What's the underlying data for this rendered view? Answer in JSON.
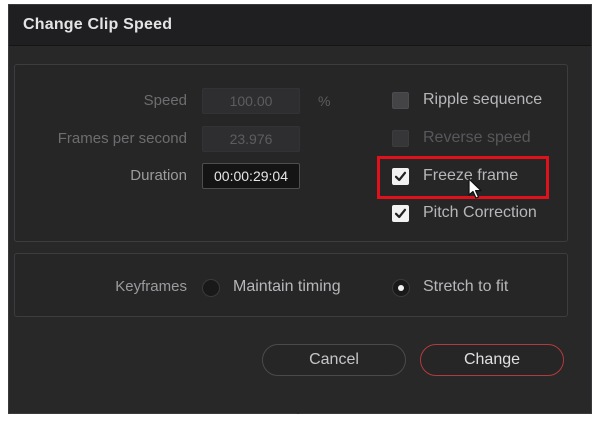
{
  "dialog": {
    "title": "Change Clip Speed",
    "accent_color": "#e0111a"
  },
  "speed_section": {
    "speed_label": "Speed",
    "speed_value": "100.00",
    "speed_unit": "%",
    "fps_label": "Frames per second",
    "fps_value": "23.976",
    "duration_label": "Duration",
    "duration_value": "00:00:29:04"
  },
  "options": {
    "ripple_sequence": {
      "label": "Ripple sequence",
      "checked": false,
      "enabled": true
    },
    "reverse_speed": {
      "label": "Reverse speed",
      "checked": false,
      "enabled": false
    },
    "freeze_frame": {
      "label": "Freeze frame",
      "checked": true,
      "enabled": true,
      "highlighted": true
    },
    "pitch_correction": {
      "label": "Pitch Correction",
      "checked": true,
      "enabled": true
    }
  },
  "keyframes": {
    "label": "Keyframes",
    "maintain_timing": {
      "label": "Maintain timing",
      "selected": false
    },
    "stretch_to_fit": {
      "label": "Stretch to fit",
      "selected": true
    }
  },
  "buttons": {
    "cancel": "Cancel",
    "change": "Change"
  },
  "icons": {
    "checkmark": "checkmark-icon",
    "cursor": "mouse-pointer-icon"
  }
}
